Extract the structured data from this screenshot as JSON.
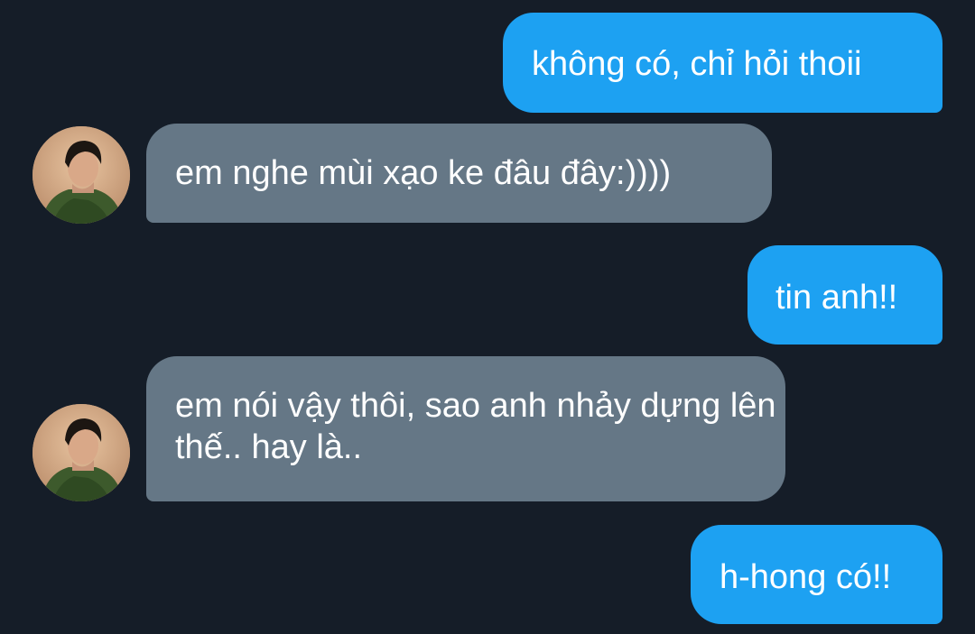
{
  "conversation": {
    "messages": [
      {
        "direction": "sent",
        "text": "không có, chỉ hỏi thoii"
      },
      {
        "direction": "received",
        "text": "em nghe mùi xạo ke đâu đây:))))",
        "avatar": "contact-avatar"
      },
      {
        "direction": "sent",
        "text": "tin anh!!"
      },
      {
        "direction": "received",
        "text": "em nói vậy thôi, sao anh nhảy dựng lên thế.. hay là..",
        "avatar": "contact-avatar"
      },
      {
        "direction": "sent",
        "text": "h-hong có!!"
      }
    ]
  },
  "colors": {
    "background": "#151d28",
    "sent_bubble": "#1da1f2",
    "received_bubble": "#657786",
    "text": "#ffffff"
  }
}
